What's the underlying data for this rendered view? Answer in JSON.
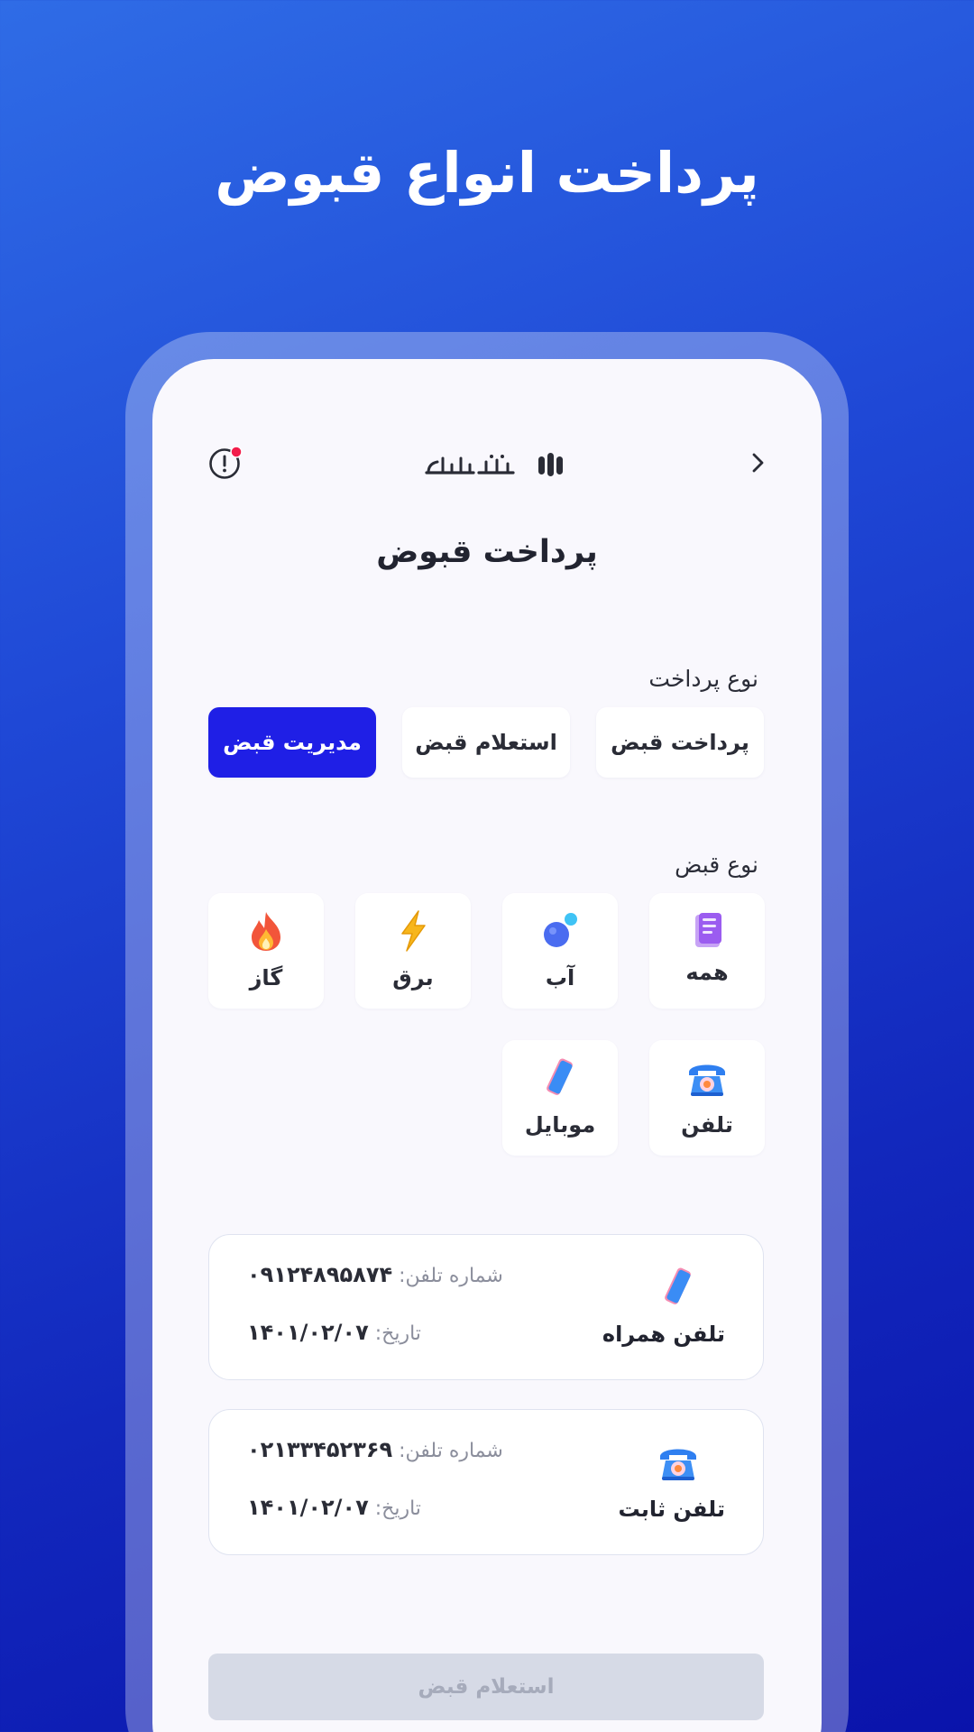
{
  "hero": {
    "title": "پرداخت انواع قبوض"
  },
  "header": {
    "logo_text": "متابانک",
    "logo_icon": "bank-logo-icon",
    "alert_icon": "alert-icon",
    "back_icon": "chevron-right-icon"
  },
  "page": {
    "title": "پرداخت قبوض"
  },
  "payment_type": {
    "label": "نوع پرداخت",
    "options": [
      {
        "label": "پرداخت قبض",
        "selected": false
      },
      {
        "label": "استعلام قبض",
        "selected": false
      },
      {
        "label": "مدیریت قبض",
        "selected": true
      }
    ]
  },
  "bill_type": {
    "label": "نوع قبض",
    "items": [
      {
        "label": "همه",
        "icon": "notebook-icon"
      },
      {
        "label": "آب",
        "icon": "water-drop-icon"
      },
      {
        "label": "برق",
        "icon": "lightning-icon"
      },
      {
        "label": "گاز",
        "icon": "flame-icon"
      },
      {
        "label": "تلفن",
        "icon": "telephone-icon"
      },
      {
        "label": "موبایل",
        "icon": "mobile-icon"
      }
    ]
  },
  "bills": [
    {
      "title": "تلفن همراه",
      "icon": "mobile-icon",
      "phone_label": "شماره تلفن:",
      "phone": "۰۹۱۲۴۸۹۵۸۷۴",
      "date_label": "تاریخ:",
      "date": "۱۴۰۱/۰۲/۰۷"
    },
    {
      "title": "تلفن ثابت",
      "icon": "telephone-icon",
      "phone_label": "شماره تلفن:",
      "phone": "۰۲۱۳۳۴۵۲۳۶۹",
      "date_label": "تاریخ:",
      "date": "۱۴۰۱/۰۲/۰۷"
    }
  ],
  "submit": {
    "label": "استعلام قبض",
    "enabled": false
  },
  "colors": {
    "accent": "#1f1fe6",
    "background_top": "#2f6ce6",
    "background_bottom": "#0a13ab",
    "disabled_button": "#d6dae6"
  }
}
